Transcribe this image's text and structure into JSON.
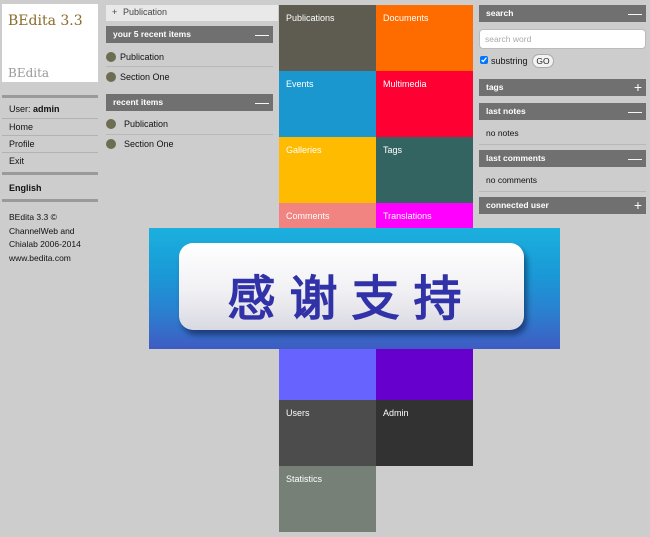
{
  "brand": {
    "title": "BEdita 3.3",
    "mark": "BEdita"
  },
  "user": {
    "label": "User:",
    "name": "admin"
  },
  "nav": [
    {
      "label": "Home"
    },
    {
      "label": "Profile"
    },
    {
      "label": "Exit"
    }
  ],
  "language": "English",
  "credits": [
    "BEdita 3.3 ©",
    "ChannelWeb and",
    "Chialab 2006-2014",
    "www.bedita.com"
  ],
  "breadcrumb": {
    "plus": "+",
    "label": "Publication"
  },
  "recent5": {
    "title": "your 5 recent items",
    "collapse": "—",
    "items": [
      {
        "label": "Publication"
      },
      {
        "label": "Section One"
      }
    ]
  },
  "recent": {
    "title": "recent items",
    "collapse": "—",
    "items": [
      {
        "label": "Publication"
      },
      {
        "label": "Section One"
      }
    ]
  },
  "tiles": [
    {
      "label": "Publications",
      "color": "#5e5c50"
    },
    {
      "label": "Documents",
      "color": "#fe6c00"
    },
    {
      "label": "Events",
      "color": "#1b97cf"
    },
    {
      "label": "Multimedia",
      "color": "#ff0033"
    },
    {
      "label": "Galleries",
      "color": "#ffbb00"
    },
    {
      "label": "Tags",
      "color": "#346462"
    },
    {
      "label": "Comments",
      "color": "#f18381"
    },
    {
      "label": "Translations",
      "color": "#ff00ff"
    },
    {
      "label": "",
      "color": "#6663fe"
    },
    {
      "label": "",
      "color": "#6600cc"
    },
    {
      "label": "Users",
      "color": "#4c4c4c"
    },
    {
      "label": "Admin",
      "color": "#323232"
    },
    {
      "label": "Statistics",
      "color": "#768076"
    }
  ],
  "search": {
    "title": "search",
    "collapse": "—",
    "placeholder": "search word",
    "checkbox_label": "substring",
    "checked": true,
    "go_label": "GO"
  },
  "tags": {
    "title": "tags",
    "expand": "+"
  },
  "last_notes": {
    "title": "last notes",
    "collapse": "—",
    "empty": "no notes"
  },
  "last_comments": {
    "title": "last comments",
    "collapse": "—",
    "empty": "no comments"
  },
  "connected_user": {
    "title": "connected user",
    "expand": "+"
  },
  "banner": {
    "text": "感谢支持"
  }
}
